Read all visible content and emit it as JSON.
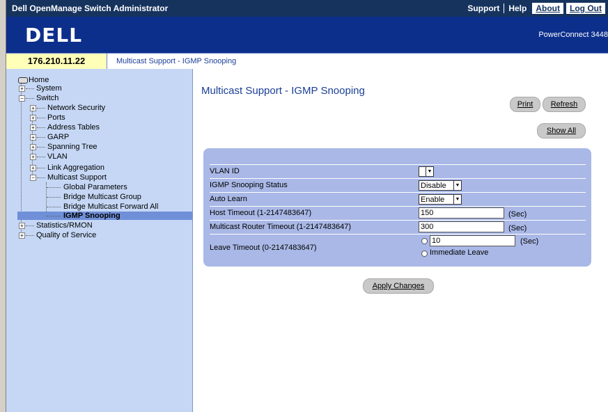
{
  "header": {
    "title": "Dell OpenManage Switch Administrator",
    "links": [
      "Support",
      "Help",
      "About",
      "Log Out"
    ]
  },
  "banner": {
    "logo": "DELL",
    "model": "PowerConnect 3448"
  },
  "address": {
    "ip": "176.210.11.22",
    "breadcrumb": "Multicast Support - IGMP Snooping"
  },
  "tree": {
    "home": "Home",
    "system": "System",
    "switch": "Switch",
    "network_security": "Network Security",
    "ports": "Ports",
    "address_tables": "Address Tables",
    "garp": "GARP",
    "spanning_tree": "Spanning Tree",
    "vlan": "VLAN",
    "link_aggregation": "Link Aggregation",
    "multicast_support": "Multicast Support",
    "global_parameters": "Global Parameters",
    "bridge_multicast_group": "Bridge Multicast Group",
    "bridge_multicast_forward_all": "Bridge Multicast Forward All",
    "igmp_snooping": "IGMP Snooping",
    "statistics_rmon": "Statistics/RMON",
    "quality_of_service": "Quality of Service"
  },
  "page": {
    "title": "Multicast Support - IGMP Snooping",
    "print_label": "Print",
    "refresh_label": "Refresh",
    "show_all_label": "Show All",
    "apply_label": "Apply Changes"
  },
  "form": {
    "vlan_id_label": "VLAN ID",
    "vlan_id_value": "",
    "snooping_status_label": "IGMP Snooping Status",
    "snooping_status_value": "Disable",
    "auto_learn_label": "Auto Learn",
    "auto_learn_value": "Enable",
    "host_timeout_label": "Host Timeout (1-2147483647)",
    "host_timeout_value": "150",
    "router_timeout_label": "Multicast Router Timeout (1-2147483647)",
    "router_timeout_value": "300",
    "leave_timeout_label": "Leave Timeout (0-2147483647)",
    "leave_timeout_value": "10",
    "immediate_leave_label": "Immediate Leave",
    "unit": "(Sec)"
  }
}
